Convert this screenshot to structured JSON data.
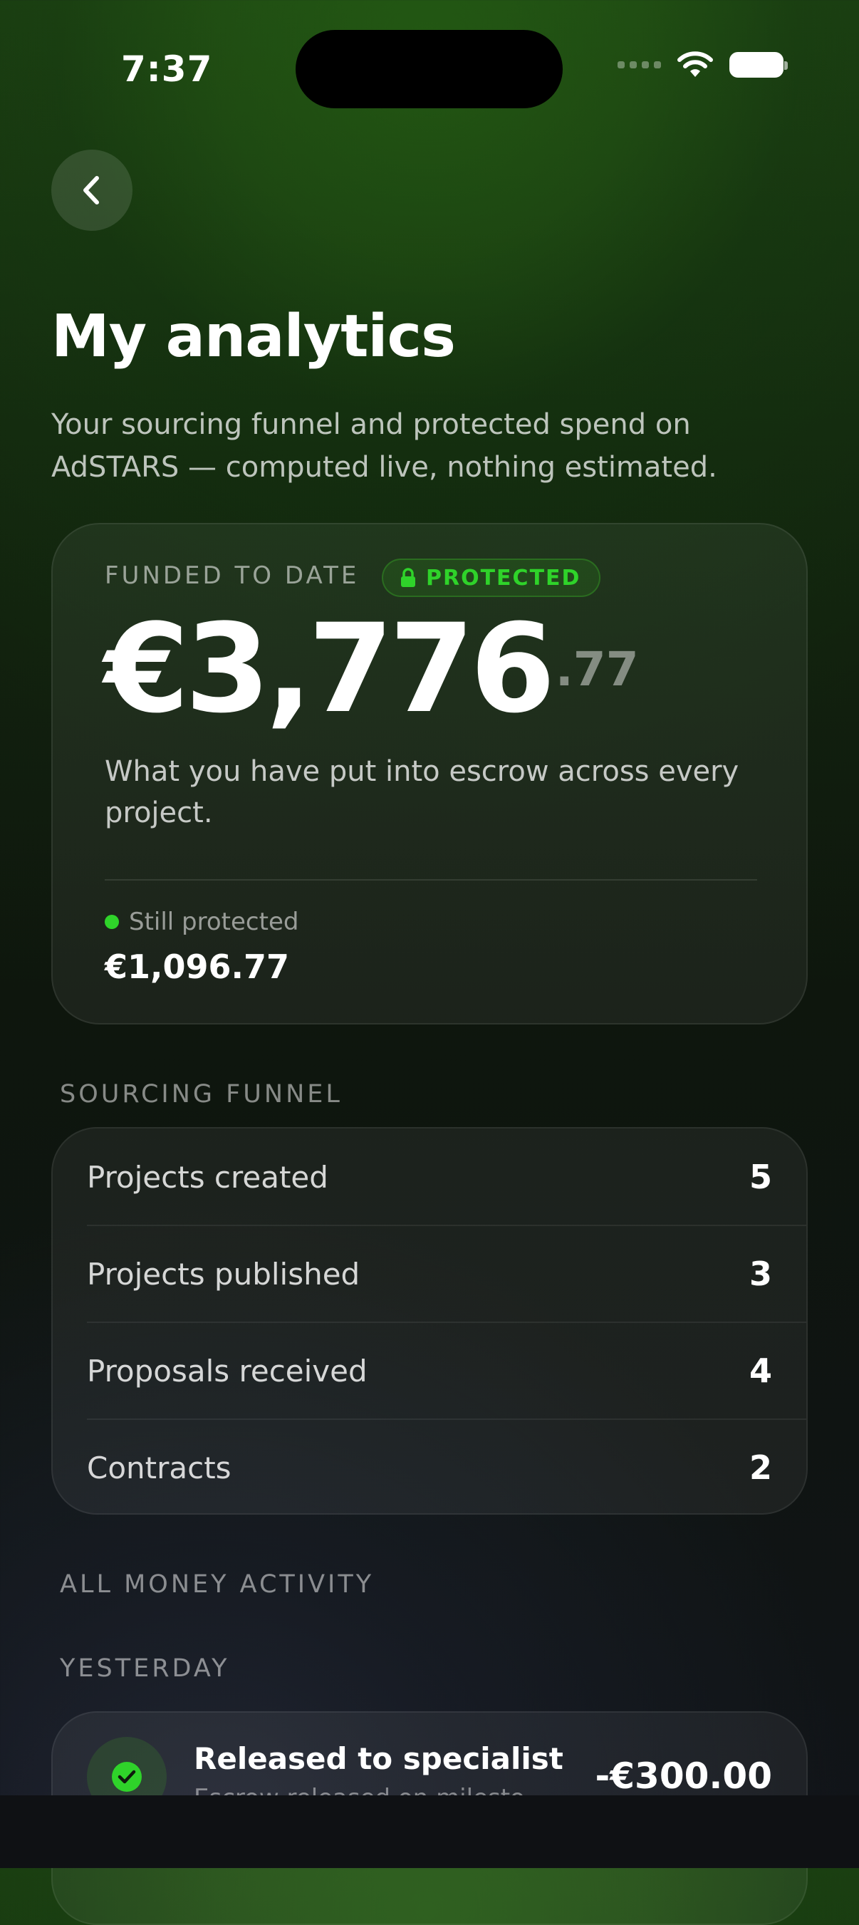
{
  "status_bar": {
    "time": "7:37"
  },
  "header": {
    "back_icon": "chevron-left-icon",
    "title": "My analytics",
    "subtitle": "Your sourcing funnel and protected spend on AdSTARS — computed live, nothing estimated."
  },
  "funded": {
    "label": "FUNDED TO DATE",
    "badge": "PROTECTED",
    "badge_icon": "lock-icon",
    "amount_main": "€3,776",
    "amount_cents": ".77",
    "description": "What you have put into escrow across every project.",
    "still_label": "Still protected",
    "still_value": "€1,096.77"
  },
  "funnel": {
    "heading": "SOURCING FUNNEL",
    "rows": [
      {
        "label": "Projects created",
        "value": "5"
      },
      {
        "label": "Projects published",
        "value": "3"
      },
      {
        "label": "Proposals received",
        "value": "4"
      },
      {
        "label": "Contracts",
        "value": "2"
      }
    ]
  },
  "activity": {
    "heading": "ALL MONEY ACTIVITY",
    "group": "YESTERDAY",
    "items": [
      {
        "icon": "check-icon",
        "title": "Released to specialist",
        "subtitle": "Escrow released on milesto",
        "amount": "-€300.00"
      }
    ]
  },
  "colors": {
    "accent_green": "#2fd32a"
  }
}
